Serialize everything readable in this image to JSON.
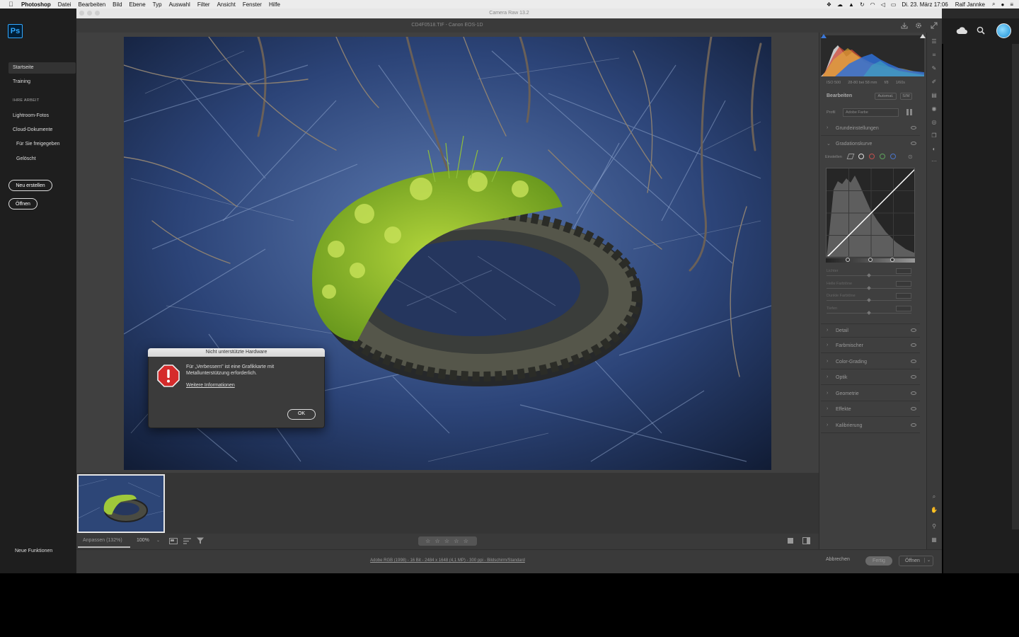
{
  "menubar": {
    "app": "Photoshop",
    "items": [
      "Datei",
      "Bearbeiten",
      "Bild",
      "Ebene",
      "Typ",
      "Auswahl",
      "Filter",
      "Ansicht",
      "Fenster",
      "Hilfe"
    ],
    "date_time": "Di. 23. März 17:06",
    "user": "Ralf Jannke"
  },
  "ps_home": {
    "logo": "Ps",
    "nav": {
      "start": "Startseite",
      "training": "Training",
      "section_heading": "IHRE ARBEIT",
      "lightroom": "Lightroom-Fotos",
      "cloud_docs": "Cloud-Dokumente",
      "shared": "Für Sie freigegeben",
      "deleted": "Gelöscht"
    },
    "new_button": "Neu erstellen",
    "open_button": "Öffnen",
    "whats_new": "Neue Funktionen"
  },
  "camera_raw": {
    "window_title": "Camera Raw 13.2",
    "file_title": "CD4F0518.TIF - Canon EOS-1D",
    "toolbar": {
      "zoom_fit": "Anpassen (132%)",
      "zoom_percent": "100%",
      "stars": "☆ ☆ ☆ ☆ ☆"
    },
    "footer": {
      "info": "Adobe RGB (1998) - 16 Bit - 2484 x 1648 (4,1 MP) - 300 ppi - Bildschirm/Standard",
      "cancel": "Abbrechen",
      "done": "Fertig",
      "open": "Öffnen"
    },
    "panel": {
      "camera_info": [
        "ISO 500",
        "28-80 bei 58 mm",
        "f/8",
        "1/60s"
      ],
      "edit_heading": "Bearbeiten",
      "auto_button": "Automat.",
      "bw_button": "S/W",
      "profile_label": "Profil",
      "profile_value": "Adobe Farbe",
      "sections": [
        {
          "label": "Grundeinstellungen"
        },
        {
          "label": "Gradationskurve"
        },
        {
          "label": "Detail"
        },
        {
          "label": "Farbmischer"
        },
        {
          "label": "Color-Grading"
        },
        {
          "label": "Optik"
        },
        {
          "label": "Geometrie"
        },
        {
          "label": "Effekte"
        },
        {
          "label": "Kalibrierung"
        }
      ],
      "curve_mode_label": "Einstellen",
      "curve_sliders": [
        "Lichter",
        "Helle Farbtöne",
        "Dunkle Farbtöne",
        "Tiefen"
      ]
    }
  },
  "dialog": {
    "title": "Nicht unterstützte Hardware",
    "message": "Für „Verbessern\" ist eine Grafikkarte mit Metallunterstützung erforderlich.",
    "link": "Weitere Informationen",
    "ok": "OK"
  },
  "colors": {
    "accent_blue": "#31a8ff",
    "alert_red": "#d52b2b"
  }
}
